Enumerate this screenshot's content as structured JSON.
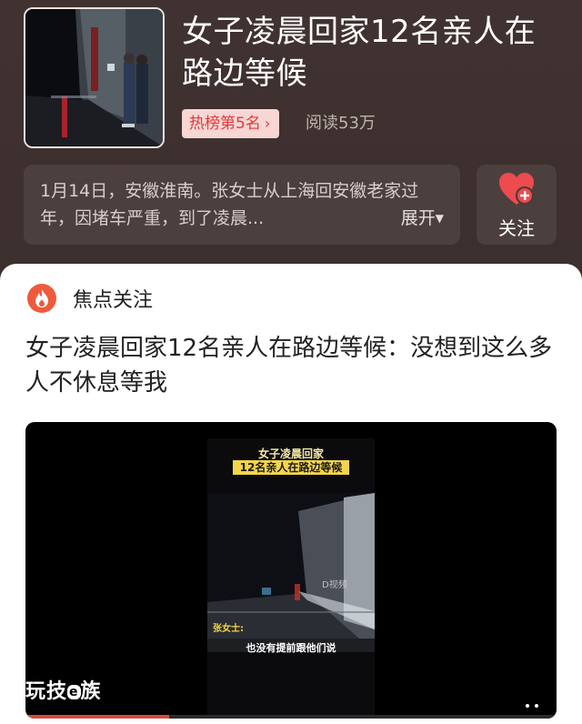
{
  "topic": {
    "title": "女子凌晨回家12名亲人在路边等候",
    "hot_rank_label": "热榜第5名",
    "read_count": "阅读53万",
    "summary": "1月14日，安徽淮南。张女士从上海回安徽老家过年，因堵车严重，到了凌晨...",
    "expand_label": "展开",
    "follow_label": "关注"
  },
  "card": {
    "section_label": "焦点关注",
    "article_title": "女子凌晨回家12名亲人在路边等候：没想到这么多人不休息等我"
  },
  "video": {
    "caption_line1": "女子凌晨回家",
    "caption_line2": "12名亲人在路边等候",
    "speaker_label": "张女士:",
    "subtitle": "也没有提前跟他们说",
    "watermark": "D视频",
    "brand_left": "玩技",
    "brand_mid": "e",
    "brand_right": "族",
    "progress": 0.27
  },
  "colors": {
    "accent": "#e4393c",
    "focus_icon": "#f05a3c",
    "caption_bg": "#f3d54a"
  }
}
